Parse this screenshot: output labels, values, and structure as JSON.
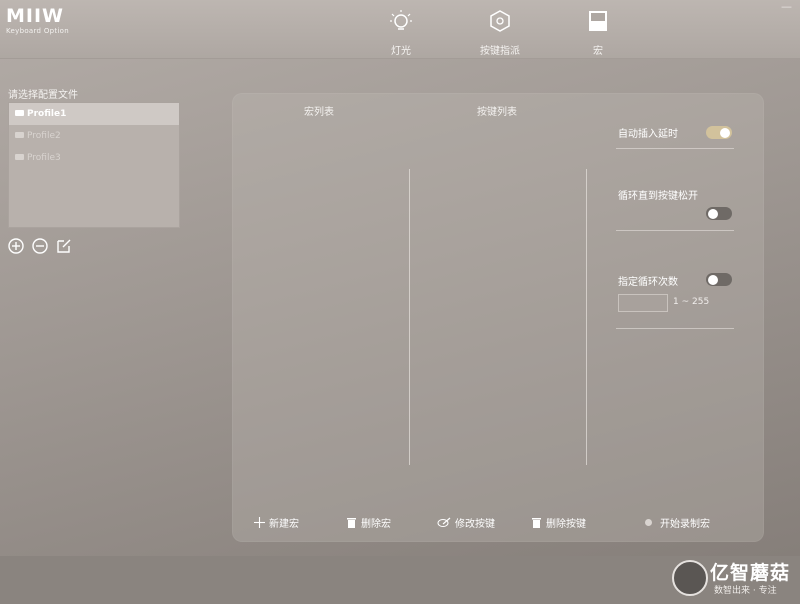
{
  "brand": {
    "logo": "MIIW",
    "subtitle": "Keyboard Option"
  },
  "nav": {
    "tabs": [
      {
        "label": "灯光",
        "icon": "light-bulb-icon"
      },
      {
        "label": "按键指派",
        "icon": "hexagon-icon"
      },
      {
        "label": "宏",
        "icon": "macro-icon"
      }
    ],
    "active": "宏"
  },
  "window": {
    "minimize": "—"
  },
  "profiles": {
    "title": "请选择配置文件",
    "items": [
      "Profile1",
      "Profile2",
      "Profile3"
    ],
    "selected": "Profile1"
  },
  "macro_panel": {
    "macro_list_header": "宏列表",
    "key_list_header": "按键列表",
    "options": {
      "auto_delay": {
        "label": "自动插入延时",
        "on": true
      },
      "loop_until_release": {
        "label": "循环直到按键松开",
        "on": false
      },
      "loop_count": {
        "label": "指定循环次数",
        "on": false,
        "value": "",
        "range": "1 ~ 255"
      }
    },
    "buttons": {
      "new_macro": "新建宏",
      "delete_macro": "删除宏",
      "edit_key": "修改按键",
      "delete_key": "删除按键",
      "record": "开始录制宏"
    }
  },
  "watermark": {
    "title": "亿智蘑菇",
    "sub": "数智出来 · 专注"
  },
  "colors": {
    "toggle_on": "#d2c29c",
    "toggle_off": "#6f6a66"
  }
}
